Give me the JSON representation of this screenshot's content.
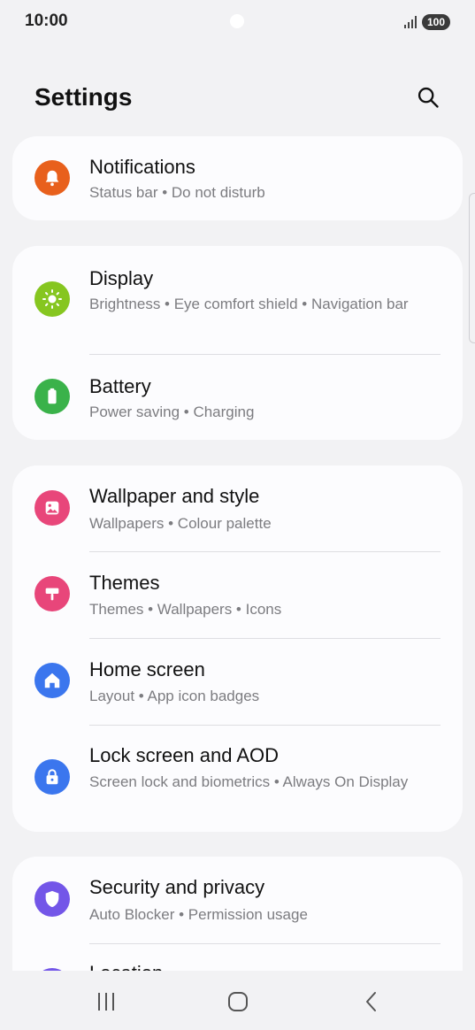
{
  "status": {
    "time": "10:00",
    "battery": "100"
  },
  "header": {
    "title": "Settings",
    "search_icon": "search-icon"
  },
  "groups": [
    {
      "items": [
        {
          "title": "Notifications",
          "subtitle": "Status bar  •  Do not disturb",
          "icon": "bell-icon",
          "color": "#e8601c"
        }
      ]
    },
    {
      "items": [
        {
          "title": "Display",
          "subtitle": "Brightness  •  Eye comfort shield  •  Navigation bar",
          "icon": "brightness-icon",
          "color": "#86c620"
        },
        {
          "title": "Battery",
          "subtitle": "Power saving  •  Charging",
          "icon": "battery-icon",
          "color": "#3ab24a"
        }
      ]
    },
    {
      "items": [
        {
          "title": "Wallpaper and style",
          "subtitle": "Wallpapers  •  Colour palette",
          "icon": "image-icon",
          "color": "#e8467a"
        },
        {
          "title": "Themes",
          "subtitle": "Themes  •  Wallpapers  •  Icons",
          "icon": "paint-roller-icon",
          "color": "#e8467a"
        },
        {
          "title": "Home screen",
          "subtitle": "Layout  •  App icon badges",
          "icon": "home-icon",
          "color": "#3b76ee"
        },
        {
          "title": "Lock screen and AOD",
          "subtitle": "Screen lock and biometrics  •  Always On Display",
          "icon": "lock-icon",
          "color": "#3b76ee"
        }
      ]
    },
    {
      "items": [
        {
          "title": "Security and privacy",
          "subtitle": "Auto Blocker  •  Permission usage",
          "icon": "shield-icon",
          "color": "#7356e8"
        },
        {
          "title": "Location",
          "subtitle": "",
          "icon": "location-icon",
          "color": "#7356e8"
        }
      ]
    }
  ],
  "nav": {
    "recents": "recents-icon",
    "home": "home-button-icon",
    "back": "back-icon"
  }
}
